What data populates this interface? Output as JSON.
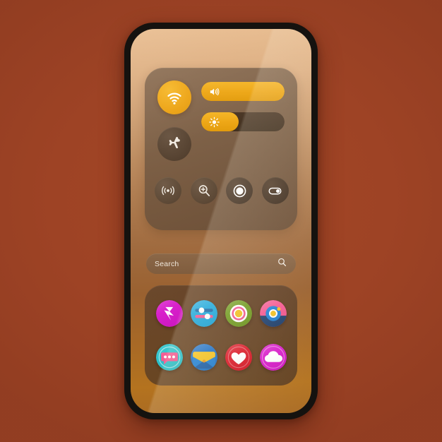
{
  "background": {
    "color": "#9e4325"
  },
  "device": {
    "frame_color": "#15120f",
    "wallpaper_top": "#e7b98b",
    "wallpaper_bottom": "#b4731f"
  },
  "control_center": {
    "toggles": [
      {
        "name": "wifi",
        "label": "Wi-Fi",
        "icon": "wifi-icon",
        "state": "on",
        "color": "#eda416"
      },
      {
        "name": "airplane",
        "label": "Airplane mode",
        "icon": "airplane-icon",
        "state": "off",
        "color": "#54412f"
      }
    ],
    "sliders": [
      {
        "name": "volume",
        "label": "Volume",
        "icon": "volume-icon",
        "value": 100,
        "fill_color": "#eda615"
      },
      {
        "name": "brightness",
        "label": "Brightness",
        "icon": "brightness-icon",
        "value": 45,
        "fill_color": "#eda615"
      }
    ],
    "quick_actions": [
      {
        "name": "hotspot",
        "label": "Hotspot",
        "icon": "hotspot-icon",
        "state": "off"
      },
      {
        "name": "magnifier",
        "label": "Magnifier",
        "icon": "magnifier-plus-icon",
        "state": "off"
      },
      {
        "name": "record",
        "label": "Screen record",
        "icon": "record-circle-icon",
        "state": "off"
      },
      {
        "name": "toggle",
        "label": "Quick toggle",
        "icon": "toggle-switch-icon",
        "state": "on"
      }
    ]
  },
  "search": {
    "placeholder": "Search",
    "icon": "search-icon"
  },
  "dock": {
    "apps": [
      {
        "name": "bolt",
        "label": "Bolt",
        "icon": "lightning-bolt-icon",
        "bg": "#d717c9",
        "fg": "#ffffff"
      },
      {
        "name": "settings",
        "label": "Settings",
        "icon": "sliders-icon",
        "bg": "#19a7dd",
        "fg": "#ffffff"
      },
      {
        "name": "gallery",
        "label": "Gallery",
        "icon": "target-rings-icon",
        "bg": "#6f9a1e",
        "fg": "#f3c01f"
      },
      {
        "name": "camera",
        "label": "Camera",
        "icon": "camera-lens-icon",
        "bg": "#f4548f",
        "fg": "#1d58a8"
      },
      {
        "name": "messages",
        "label": "Messages",
        "icon": "chat-bubble-icon",
        "bg": "#24c0c9",
        "fg": "#f4548f"
      },
      {
        "name": "mail",
        "label": "Mail",
        "icon": "envelope-icon",
        "bg": "#1d6fc4",
        "fg": "#f5c21d"
      },
      {
        "name": "health",
        "label": "Health",
        "icon": "heart-icon",
        "bg": "#d91423",
        "fg": "#ffffff"
      },
      {
        "name": "cloud",
        "label": "Cloud",
        "icon": "cloud-icon",
        "bg": "#d717c9",
        "fg": "#ffffff"
      }
    ]
  }
}
